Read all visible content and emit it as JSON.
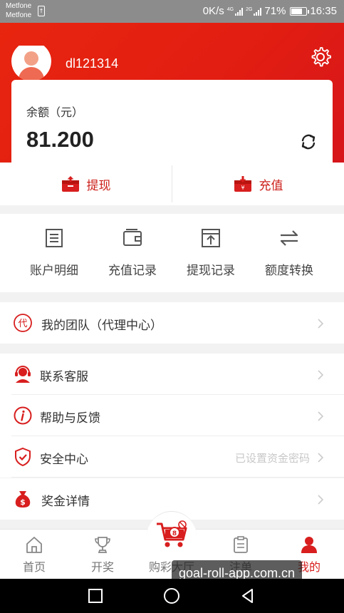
{
  "status_bar": {
    "carriers": [
      "Metfone",
      "Metfone"
    ],
    "net_speed": "0K/s",
    "net_4g": "4G",
    "net_2g": "2G",
    "battery": "71%",
    "battery_level": 0.71,
    "time": "16:35"
  },
  "profile": {
    "username": "dl121314"
  },
  "balance": {
    "label": "余额（元）",
    "value": "81.200"
  },
  "actions": {
    "withdraw": "提现",
    "recharge": "充值"
  },
  "records": [
    {
      "label": "账户明细",
      "icon": "account-detail-icon"
    },
    {
      "label": "充值记录",
      "icon": "wallet-icon"
    },
    {
      "label": "提现记录",
      "icon": "withdraw-record-icon"
    },
    {
      "label": "额度转换",
      "icon": "transfer-icon"
    }
  ],
  "menu": {
    "team": {
      "label": "我的团队（代理中心）",
      "icon": "agent-icon"
    },
    "service": {
      "label": "联系客服",
      "icon": "customer-service-icon"
    },
    "help": {
      "label": "帮助与反馈",
      "icon": "info-icon"
    },
    "security": {
      "label": "安全中心",
      "hint": "已设置资金密码",
      "icon": "shield-icon"
    },
    "bonus": {
      "label": "奖金详情",
      "icon": "money-bag-icon"
    }
  },
  "tabs": [
    {
      "label": "首页",
      "icon": "home-icon"
    },
    {
      "label": "开奖",
      "icon": "trophy-icon"
    },
    {
      "label": "购彩大厅",
      "icon": "cart-icon"
    },
    {
      "label": "注单",
      "icon": "clipboard-icon"
    },
    {
      "label": "我的",
      "icon": "user-icon",
      "active": true
    }
  ],
  "watermark": "goal-roll-app.com.cn",
  "colors": {
    "brand_red": "#e11d12",
    "accent_red": "#cc1f1a",
    "background": "#f2f2f2"
  }
}
